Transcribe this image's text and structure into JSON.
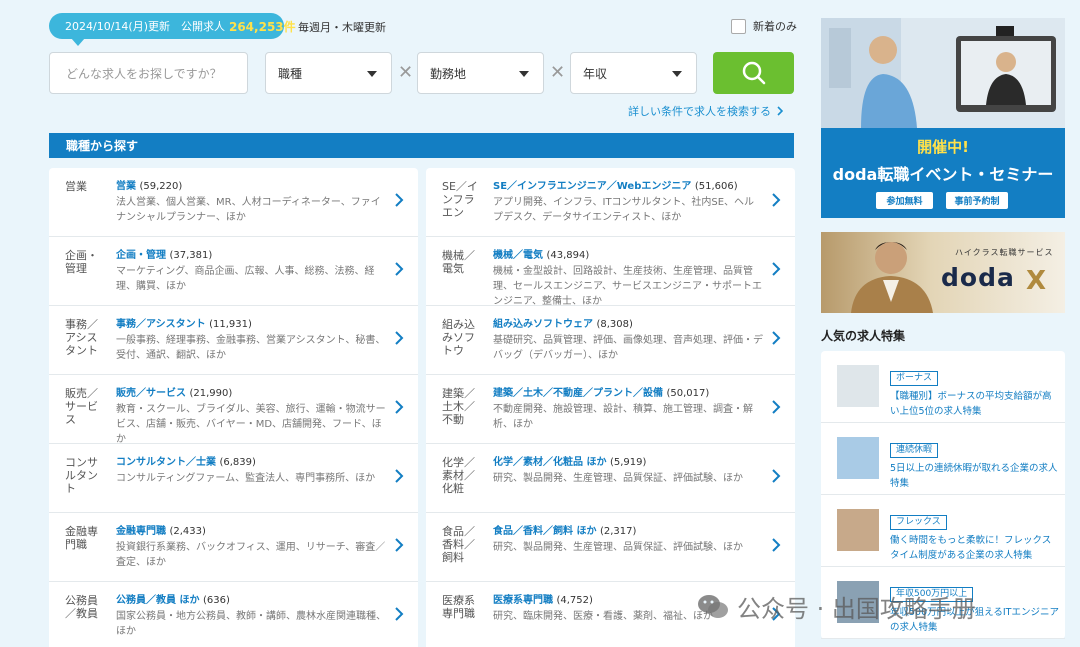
{
  "header": {
    "count_prefix": "2024/10/14(月)更新　公開求人",
    "count_number": "264,253件",
    "update_note": "毎週月・木曜更新",
    "new_only_label": "新着のみ"
  },
  "search": {
    "keyword_placeholder": "どんな求人をお探しですか？",
    "job_type": "職種",
    "location": "勤務地",
    "salary": "年収",
    "detail_link": "詳しい条件で求人を検索する"
  },
  "section_title": "職種から探す",
  "categories_left": [
    {
      "img_alt": "営業",
      "title": "営業",
      "count": "(59,220)",
      "desc": "法人営業、個人営業、MR、人材コーディネーター、ファイナンシャルプランナー、ほか"
    },
    {
      "img_alt": "企画・管理",
      "title": "企画・管理",
      "count": "(37,381)",
      "desc": "マーケティング、商品企画、広報、人事、総務、法務、経理、購買、ほか"
    },
    {
      "img_alt": "事務／アシスタント",
      "title": "事務／アシスタント",
      "count": "(11,931)",
      "desc": "一般事務、経理事務、金融事務、営業アシスタント、秘書、受付、通訳、翻訳、ほか"
    },
    {
      "img_alt": "販売／サービス",
      "title": "販売／サービス",
      "count": "(21,990)",
      "desc": "教育・スクール、ブライダル、美容、旅行、運輸・物流サービス、店舗・販売、バイヤー・MD、店舗開発、フード、ほか"
    },
    {
      "img_alt": "コンサルタント",
      "title": "コンサルタント／士業",
      "count": "(6,839)",
      "desc": "コンサルティングファーム、監査法人、専門事務所、ほか"
    },
    {
      "img_alt": "金融専門職",
      "title": "金融専門職",
      "count": "(2,433)",
      "desc": "投資銀行系業務、バックオフィス、運用、リサーチ、審査／査定、ほか"
    },
    {
      "img_alt": "公務員／教員",
      "title": "公務員／教員 ほか",
      "count": "(636)",
      "desc": "国家公務員・地方公務員、教師・講師、農林水産関連職種、ほか"
    }
  ],
  "categories_right": [
    {
      "img_alt": "SE／インフラエン",
      "title": "SE／インフラエンジニア／Webエンジニア",
      "count": "(51,606)",
      "desc": "アプリ開発、インフラ、ITコンサルタント、社内SE、ヘルプデスク、データサイエンティスト、ほか"
    },
    {
      "img_alt": "機械／電気",
      "title": "機械／電気",
      "count": "(43,894)",
      "desc": "機械・金型設計、回路設計、生産技術、生産管理、品質管理、セールスエンジニア、サービスエンジニア・サポートエンジニア、整備士、ほか"
    },
    {
      "img_alt": "組み込みソフトウ",
      "title": "組み込みソフトウェア",
      "count": "(8,308)",
      "desc": "基礎研究、品質管理、評価、画像処理、音声処理、評価・デバッグ（デバッガー）、ほか"
    },
    {
      "img_alt": "建築／土木／不動",
      "title": "建築／土木／不動産／プラント／設備",
      "count": "(50,017)",
      "desc": "不動産開発、施設管理、設計、積算、施工管理、調査・解析、ほか"
    },
    {
      "img_alt": "化学／素材／化粧",
      "title": "化学／素材／化粧品 ほか",
      "count": "(5,919)",
      "desc": "研究、製品開発、生産管理、品質保証、評価試験、ほか"
    },
    {
      "img_alt": "食品／香料／飼料",
      "title": "食品／香料／飼料 ほか",
      "count": "(2,317)",
      "desc": "研究、製品開発、生産管理、品質保証、評価試験、ほか"
    },
    {
      "img_alt": "医療系専門職",
      "title": "医療系専門職",
      "count": "(4,752)",
      "desc": "研究、臨床開発、医療・看護、薬剤、福祉、ほか"
    }
  ],
  "seminar": {
    "title1": "開催中!",
    "title2": "doda転職イベント・セミナー",
    "btn_free": "参加無料",
    "btn_reserve": "事前予約制"
  },
  "dodax": {
    "sub": "ハイクラス転職サービス",
    "logo": "doda",
    "x": "X"
  },
  "popular_title": "人気の求人特集",
  "features": [
    {
      "badge": "ボーナス",
      "text": "【職種別】ボーナスの平均支給額が高い上位5位の求人特集"
    },
    {
      "badge": "連続休暇",
      "text": "5日以上の連続休暇が取れる企業の求人特集"
    },
    {
      "badge": "フレックス",
      "text": "働く時間をもっと柔軟に！フレックスタイム制度がある企業の求人特集"
    },
    {
      "badge": "年収500万円以上",
      "text": "年収500万円以上が狙えるITエンジニアの求人特集"
    }
  ],
  "watermark": "公众号 · 出国攻略手册",
  "colors": {
    "brand_blue": "#137ec3",
    "search_green": "#6bbf30",
    "pill": "#3cb6dc",
    "accent_yellow": "#ffe14a"
  }
}
